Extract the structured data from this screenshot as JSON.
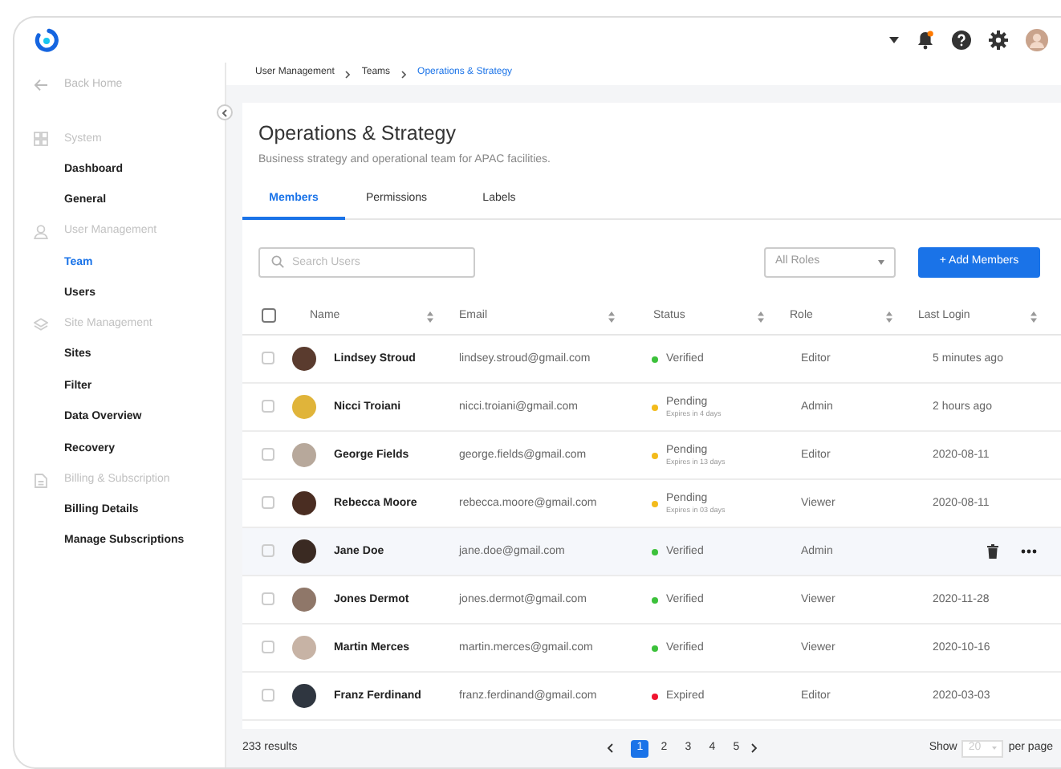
{
  "header": {
    "notification": true
  },
  "sidebar": {
    "back": "Back Home",
    "sections": [
      {
        "title": "System",
        "kind": "grid",
        "items": [
          {
            "label": "Dashboard",
            "selected": false
          },
          {
            "label": "General",
            "selected": false
          }
        ]
      },
      {
        "title": "User Management",
        "kind": "person",
        "items": [
          {
            "label": "Team",
            "selected": true
          },
          {
            "label": "Users",
            "selected": false
          }
        ]
      },
      {
        "title": "Site Management",
        "kind": "layers",
        "items": [
          {
            "label": "Sites",
            "selected": false
          },
          {
            "label": "Filter",
            "selected": false
          },
          {
            "label": "Data Overview",
            "selected": false
          },
          {
            "label": "Recovery",
            "selected": false
          }
        ]
      },
      {
        "title": "Billing & Subscription",
        "kind": "document",
        "items": [
          {
            "label": "Billing Details",
            "selected": false
          },
          {
            "label": "Manage Subscriptions",
            "selected": false
          }
        ]
      }
    ]
  },
  "breadcrumb": [
    {
      "label": "User Management",
      "current": false
    },
    {
      "label": "Teams",
      "current": false
    },
    {
      "label": "Operations & Strategy",
      "current": true
    }
  ],
  "page": {
    "title": "Operations & Strategy",
    "description": "Business strategy and operational team for APAC facilities."
  },
  "tabs": [
    {
      "label": "Members",
      "selected": true
    },
    {
      "label": "Permissions",
      "selected": false
    },
    {
      "label": "Labels",
      "selected": false
    }
  ],
  "search": {
    "placeholder": "Search Users"
  },
  "role_filter": {
    "value": "All Roles"
  },
  "add_button": "+ Add Members",
  "table": {
    "select_all": false,
    "columns": [
      "Name",
      "Email",
      "Status",
      "Role",
      "Last Login"
    ],
    "rows": [
      {
        "name": "Lindsey Stroud",
        "email": "lindsey.stroud@gmail.com",
        "status": {
          "label": "Verified",
          "color": "#3cc13b"
        },
        "role": "Editor",
        "last_login": "5 minutes ago",
        "checked": false,
        "hovered": false
      },
      {
        "name": "Nicci Troiani",
        "email": "nicci.troiani@gmail.com",
        "status": {
          "label": "Pending",
          "note": "Expires in 4 days",
          "color": "#f3bb1c"
        },
        "role": "Admin",
        "last_login": "2 hours ago",
        "checked": false,
        "hovered": false
      },
      {
        "name": "George Fields",
        "email": "george.fields@gmail.com",
        "status": {
          "label": "Pending",
          "note": "Expires in 13 days",
          "color": "#f3bb1c"
        },
        "role": "Editor",
        "last_login": "2020-08-11",
        "checked": false,
        "hovered": false
      },
      {
        "name": "Rebecca Moore",
        "email": "rebecca.moore@gmail.com",
        "status": {
          "label": "Pending",
          "note": "Expires in 03 days",
          "color": "#f3bb1c"
        },
        "role": "Viewer",
        "last_login": "2020-08-11",
        "checked": false,
        "hovered": false
      },
      {
        "name": "Jane Doe",
        "email": "jane.doe@gmail.com",
        "status": {
          "label": "Verified",
          "color": "#3cc13b"
        },
        "role": "Admin",
        "checked": false,
        "hovered": true
      },
      {
        "name": "Jones Dermot",
        "email": "jones.dermot@gmail.com",
        "status": {
          "label": "Verified",
          "color": "#3cc13b"
        },
        "role": "Viewer",
        "last_login": "2020-11-28",
        "checked": false,
        "hovered": false
      },
      {
        "name": "Martin Merces",
        "email": "martin.merces@gmail.com",
        "status": {
          "label": "Verified",
          "color": "#3cc13b"
        },
        "role": "Viewer",
        "last_login": "2020-10-16",
        "checked": false,
        "hovered": false
      },
      {
        "name": "Franz Ferdinand",
        "email": "franz.ferdinand@gmail.com",
        "status": {
          "label": "Expired",
          "color": "#f0142f"
        },
        "role": "Editor",
        "last_login": "2020-03-03",
        "checked": false,
        "hovered": false
      }
    ]
  },
  "footer": {
    "results": "233 results",
    "pages": [
      {
        "label": "1",
        "selected": true
      },
      {
        "label": "2",
        "selected": false
      },
      {
        "label": "3",
        "selected": false
      },
      {
        "label": "4",
        "selected": false
      },
      {
        "label": "5",
        "selected": false
      }
    ],
    "show_label": "Show",
    "page_size": "20",
    "per_page": "per page"
  }
}
